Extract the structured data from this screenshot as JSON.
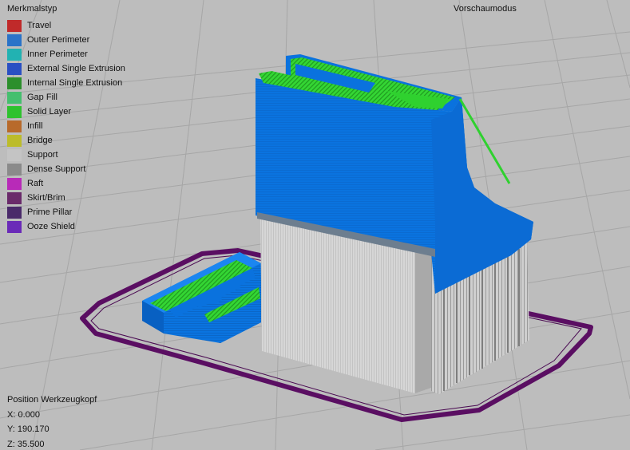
{
  "legend": {
    "title": "Merkmalstyp",
    "items": [
      {
        "label": "Travel",
        "color": "#c02a2a"
      },
      {
        "label": "Outer Perimeter",
        "color": "#2a73c8"
      },
      {
        "label": "Inner Perimeter",
        "color": "#22b2b2"
      },
      {
        "label": "External Single Extrusion",
        "color": "#2a4fc3"
      },
      {
        "label": "Internal Single Extrusion",
        "color": "#2c8f2c"
      },
      {
        "label": "Gap Fill",
        "color": "#45bf6e"
      },
      {
        "label": "Solid Layer",
        "color": "#2ec22e"
      },
      {
        "label": "Infill",
        "color": "#b86a2b"
      },
      {
        "label": "Bridge",
        "color": "#bcbc2b"
      },
      {
        "label": "Support",
        "color": "#c4c4c4"
      },
      {
        "label": "Dense Support",
        "color": "#8a8a8a"
      },
      {
        "label": "Raft",
        "color": "#b82ab8"
      },
      {
        "label": "Skirt/Brim",
        "color": "#6a2a6a"
      },
      {
        "label": "Prime Pillar",
        "color": "#4a2a6a"
      },
      {
        "label": "Ooze Shield",
        "color": "#6a2ab8"
      }
    ]
  },
  "view_mode": "Vorschaumodus",
  "position": {
    "title": "Position Werkzeugkopf",
    "x": "X: 0.000",
    "y": "Y: 190.170",
    "z": "Z: 35.500"
  },
  "colors": {
    "background": "#bdbdbd",
    "grid": "#a7a7a7",
    "perimeter_blue": "#0a72de",
    "solid_green": "#2fd12f",
    "support_grey": "#d4d4d4",
    "skirt_purple": "#5a0e62"
  }
}
